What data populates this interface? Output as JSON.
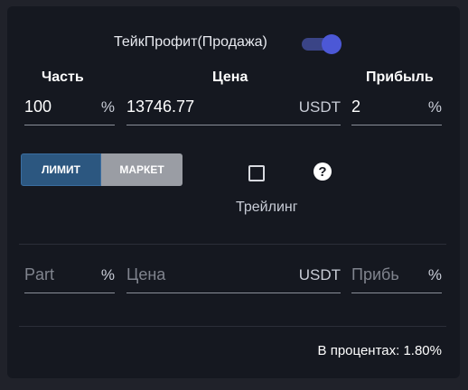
{
  "header": {
    "title": "ТейкПрофит(Продажа)",
    "toggle_on": true
  },
  "columns": {
    "part": "Часть",
    "price": "Цена",
    "profit": "Прибыль"
  },
  "row1": {
    "part_value": "100",
    "part_unit": "%",
    "price_value": "13746.77",
    "price_unit": "USDT",
    "profit_value": "2",
    "profit_unit": "%"
  },
  "order_type": {
    "limit_label": "ЛИМИТ",
    "market_label": "МАРКЕТ",
    "selected": "ЛИМИТ"
  },
  "trailing": {
    "label": "Трейлинг",
    "checked": false,
    "help_glyph": "?"
  },
  "row2": {
    "part_placeholder": "Part",
    "part_unit": "%",
    "price_placeholder": "Цена",
    "price_unit": "USDT",
    "profit_placeholder": "Прибь",
    "profit_unit": "%"
  },
  "footer": {
    "percent_text": "В процентах: 1.80%"
  },
  "colors": {
    "background": "#151820",
    "accent": "#4c58d6",
    "limit_active": "#2c5780",
    "market_inactive": "#9a9da4"
  }
}
